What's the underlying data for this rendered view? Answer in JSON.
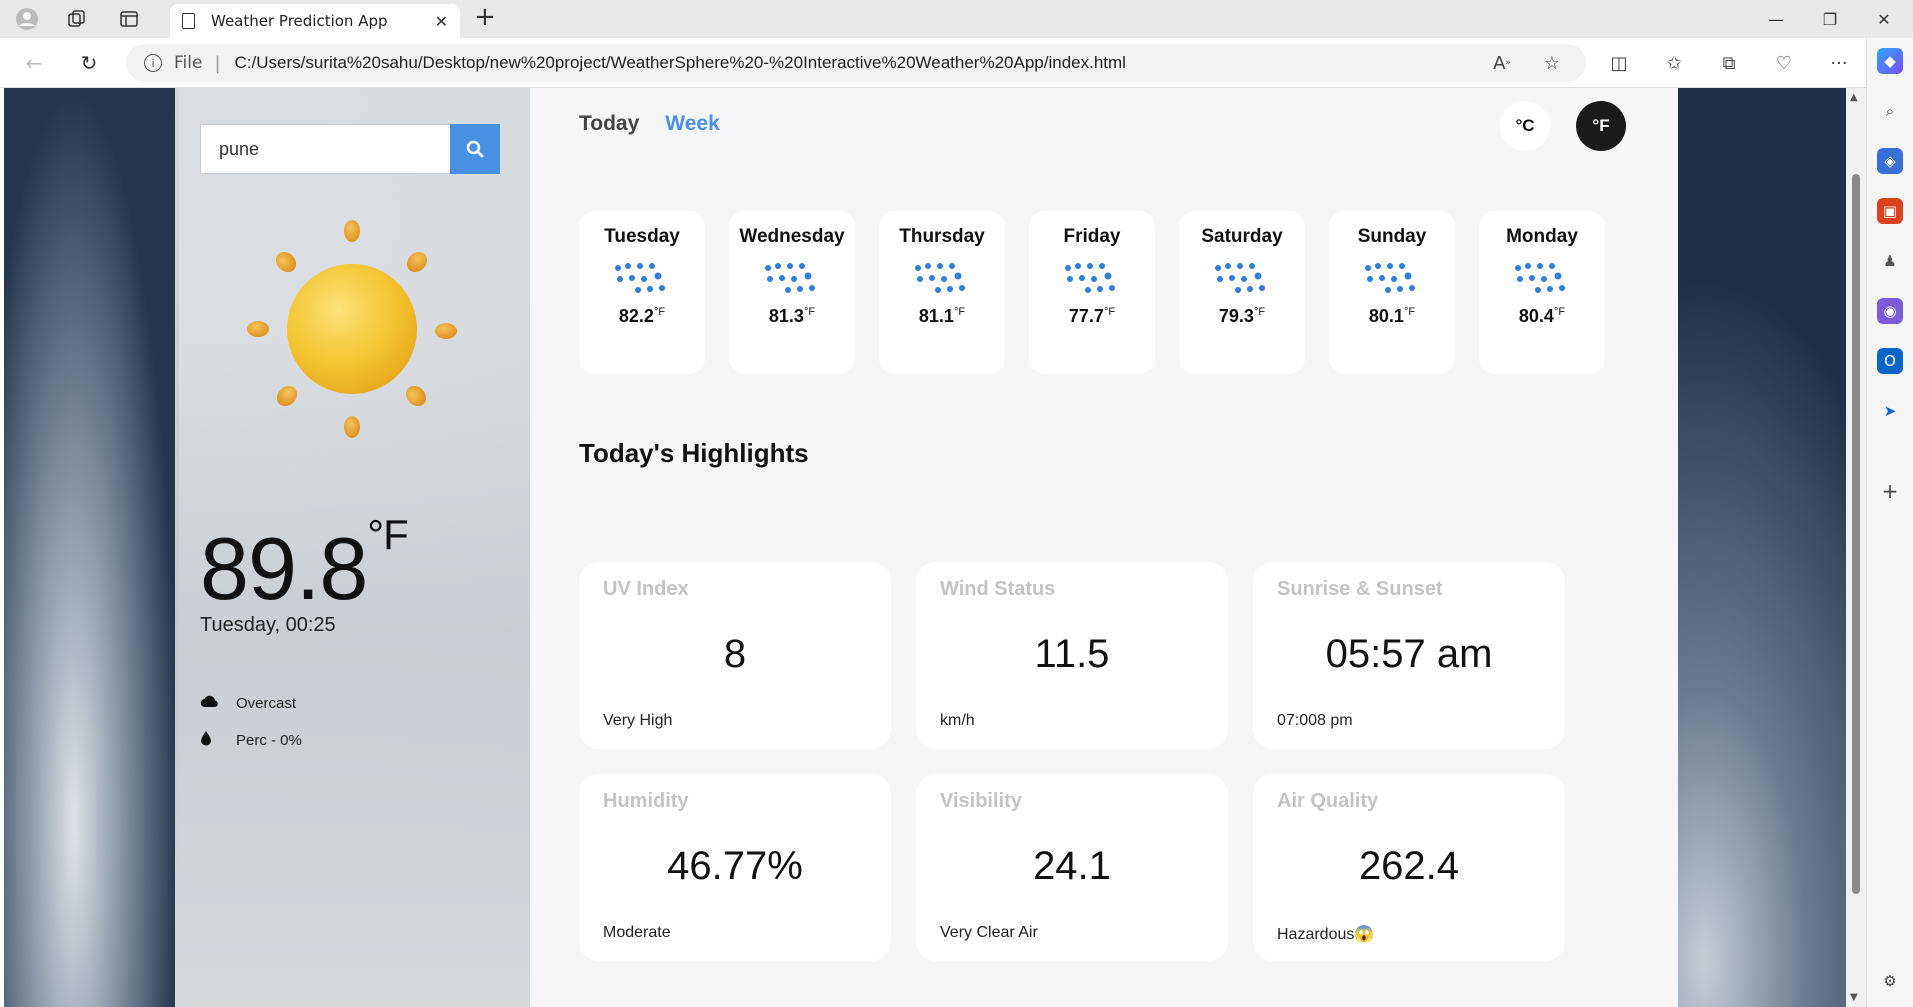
{
  "browser": {
    "tab_title": "Weather Prediction App",
    "url_scheme": "File",
    "url": "C:/Users/surita%20sahu/Desktop/new%20project/WeatherSphere%20-%20Interactive%20Weather%20App/index.html"
  },
  "search": {
    "value": "pune"
  },
  "current": {
    "temperature": "89.8",
    "unit": "°F",
    "datetime": "Tuesday, 00:25",
    "condition": "Overcast",
    "precipitation": "Perc - 0%"
  },
  "tabs": {
    "today": "Today",
    "week": "Week"
  },
  "units": {
    "celsius": "°C",
    "fahrenheit": "°F",
    "active": "fahrenheit"
  },
  "forecast": [
    {
      "day": "Tuesday",
      "temp": "82.2",
      "unit": "°F",
      "icon": "rain-icon"
    },
    {
      "day": "Wednesday",
      "temp": "81.3",
      "unit": "°F",
      "icon": "rain-icon"
    },
    {
      "day": "Thursday",
      "temp": "81.1",
      "unit": "°F",
      "icon": "rain-icon"
    },
    {
      "day": "Friday",
      "temp": "77.7",
      "unit": "°F",
      "icon": "rain-icon"
    },
    {
      "day": "Saturday",
      "temp": "79.3",
      "unit": "°F",
      "icon": "rain-icon"
    },
    {
      "day": "Sunday",
      "temp": "80.1",
      "unit": "°F",
      "icon": "rain-icon"
    },
    {
      "day": "Monday",
      "temp": "80.4",
      "unit": "°F",
      "icon": "rain-icon"
    }
  ],
  "highlights": {
    "title": "Today's Highlights",
    "uv": {
      "label": "UV Index",
      "value": "8",
      "status": "Very High"
    },
    "wind": {
      "label": "Wind Status",
      "value": "11.5",
      "status": "km/h"
    },
    "sun": {
      "label": "Sunrise & Sunset",
      "value": "05:57 am",
      "status": "07:008 pm"
    },
    "humidity": {
      "label": "Humidity",
      "value": "46.77%",
      "status": "Moderate"
    },
    "visibility": {
      "label": "Visibility",
      "value": "24.1",
      "status": "Very Clear Air"
    },
    "air": {
      "label": "Air Quality",
      "value": "262.4",
      "status": "Hazardous😱"
    }
  },
  "colors": {
    "accent": "#4a90e2",
    "rain": "#2f7fd8"
  }
}
